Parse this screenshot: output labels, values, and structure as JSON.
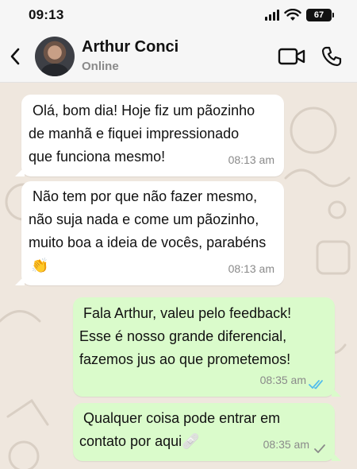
{
  "status_bar": {
    "time": "09:13",
    "battery": "67",
    "icons": [
      "signal-icon",
      "wifi-icon",
      "battery-icon"
    ]
  },
  "header": {
    "back_icon": "chevron-left-icon",
    "contact_name": "Arthur Conci",
    "contact_status": "Online",
    "actions": [
      "video-call-icon",
      "phone-icon"
    ]
  },
  "messages": [
    {
      "direction": "incoming",
      "text": " Olá, bom dia! Hoje fiz um pãozinho\nde manhã e fiquei impressionado\nque funciona mesmo!",
      "time": "08:13 am"
    },
    {
      "direction": "incoming",
      "text": " Não tem por que não fazer mesmo,\nnão suja nada e come um pãozinho,\nmuito boa a ideia de vocês, parabéns",
      "emoji": "👏",
      "time": "08:13 am"
    },
    {
      "direction": "outgoing",
      "text": " Fala Arthur, valeu pelo feedback!\nEsse é nosso grande diferencial,\nfazemos jus ao que prometemos!",
      "time": "08:35 am",
      "status": "read"
    },
    {
      "direction": "outgoing",
      "text": " Qualquer coisa pode entrar em\ncontato por aqui",
      "emoji": "🩹",
      "time": "08:35 am",
      "status": "sent"
    }
  ],
  "colors": {
    "wallpaper": "#efe7de",
    "incoming_bubble": "#ffffff",
    "outgoing_bubble": "#dafbcb",
    "read_receipt": "#53bdeb",
    "sent_check": "#8a8a8a"
  }
}
